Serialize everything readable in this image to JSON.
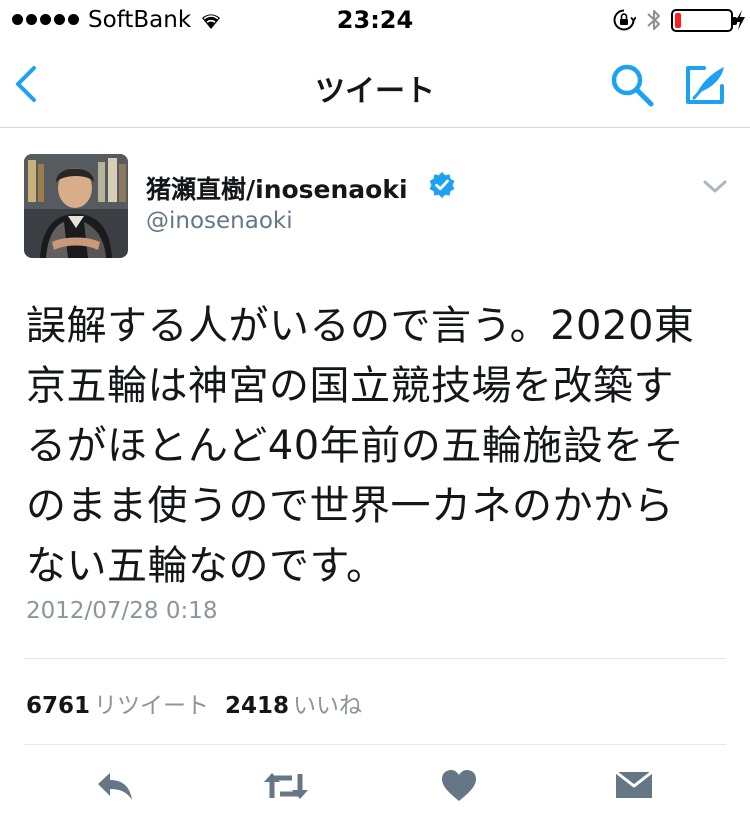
{
  "status_bar": {
    "carrier": "SoftBank",
    "time": "23:24",
    "battery_level": 0.12
  },
  "nav": {
    "title": "ツイート",
    "back_icon": "chevron-left-icon",
    "search_icon": "search-icon",
    "compose_icon": "compose-icon"
  },
  "tweet": {
    "display_name": "猪瀬直樹/inosenaoki",
    "handle": "@inosenaoki",
    "verified": true,
    "text_lines": [
      "誤解する人がいるので言う。2020東",
      "京五輪は神宮の国立競技場を改築す",
      "るがほとんど40年前の五輪施設をそ",
      "のまま使うので世界一カネのかから",
      "ない五輪なのです。"
    ],
    "timestamp": "2012/07/28 0:18"
  },
  "stats": {
    "retweets": "6761",
    "retweets_label": "リツイート",
    "likes": "2418",
    "likes_label": "いいね"
  },
  "colors": {
    "accent": "#1da1f2",
    "icon_gray": "#657786",
    "battery_low": "#ff1f1f"
  }
}
